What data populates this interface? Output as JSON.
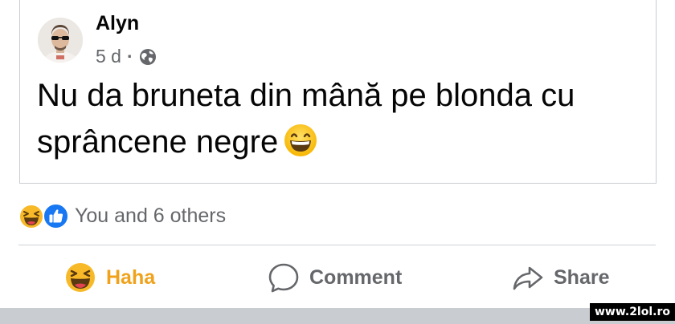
{
  "post": {
    "author": "Alyn",
    "time": "5 d",
    "separator": "·",
    "privacy_icon": "globe-icon",
    "text": "Nu da bruneta din mână pe blonda cu sprâncene negre",
    "inline_emoji": "grinning-face-emoji"
  },
  "reactions": {
    "icons": [
      "haha-reaction-icon",
      "like-reaction-icon"
    ],
    "summary": "You and 6 others"
  },
  "actions": {
    "haha_label": "Haha",
    "comment_label": "Comment",
    "share_label": "Share"
  },
  "watermark": "www.2lol.ro",
  "colors": {
    "haha_active": "#f0a21b",
    "like_blue": "#1877f2",
    "secondary_text": "#65676b",
    "border": "#c9ccd1"
  }
}
